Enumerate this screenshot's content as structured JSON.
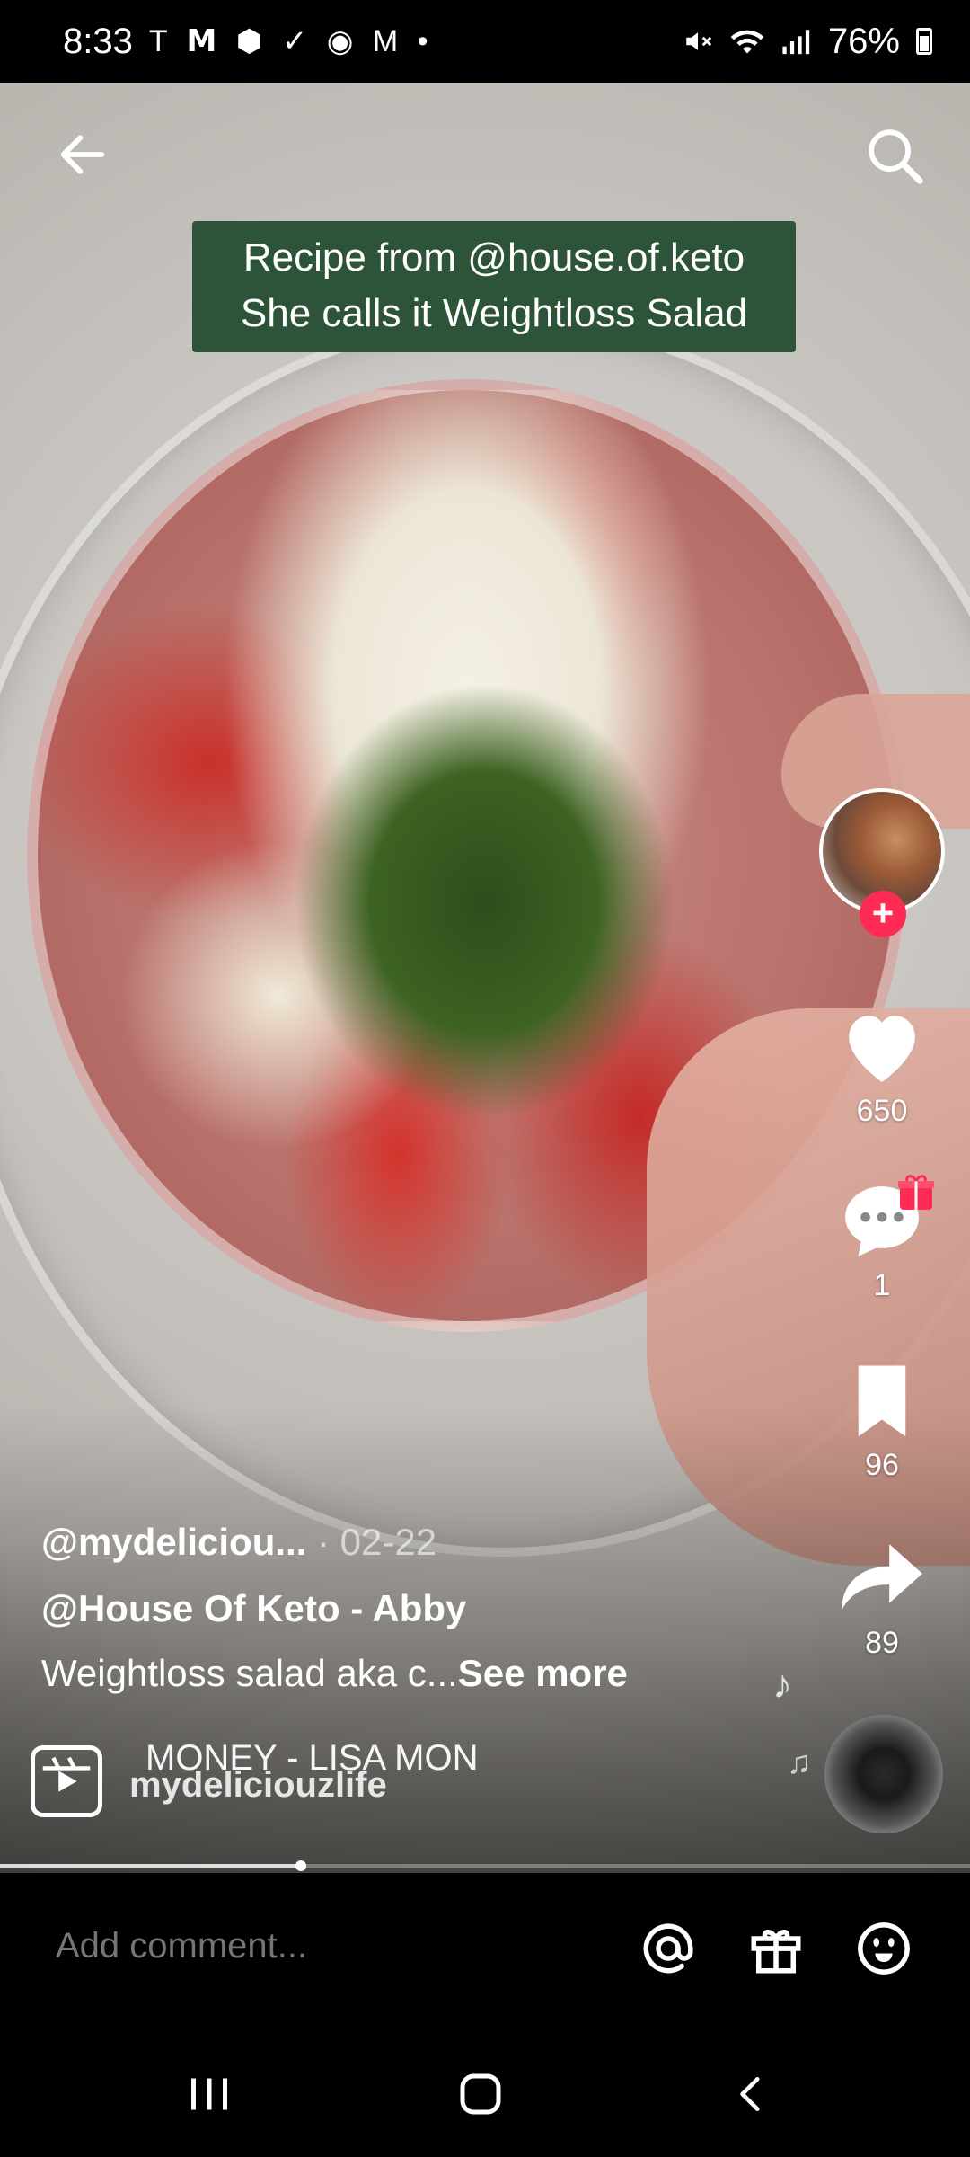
{
  "status_bar": {
    "time": "8:33",
    "left_icons": "T 𝗠 ⬢ ✓ ◉ M •",
    "battery": "76%"
  },
  "caption": {
    "line1": "Recipe from @house.of.keto",
    "line2": "She calls it Weightloss Salad"
  },
  "rail": {
    "likes": "650",
    "comments": "1",
    "saves": "96",
    "shares": "89"
  },
  "post": {
    "username": "@mydeliciou...",
    "date": " · 02-22",
    "tagline": "@House Of Keto - Abby",
    "description": "Weightloss salad aka c...",
    "see_more": "See more"
  },
  "sound": {
    "track_text": "MONEY - LISA    MON",
    "user": "mydeliciouzlife"
  },
  "progress": {
    "fraction": 0.31
  },
  "comment_bar": {
    "placeholder": "Add comment..."
  },
  "icons": [
    "back-arrow-icon",
    "search-icon",
    "heart-icon",
    "comment-icon",
    "gift-icon",
    "bookmark-icon",
    "share-icon",
    "music-note-icon",
    "at-icon",
    "emoji-icon",
    "recents-icon",
    "home-icon",
    "back-icon"
  ],
  "colors": {
    "caption_bg": "#2d5438",
    "follow_plus": "#fe2c55"
  }
}
